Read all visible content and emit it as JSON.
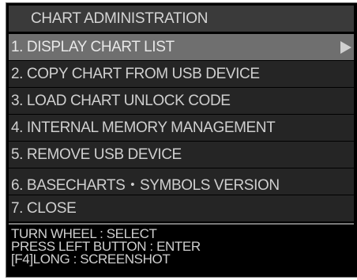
{
  "window": {
    "title": "CHART ADMINISTRATION"
  },
  "menu": {
    "items": [
      {
        "label": "1. DISPLAY CHART LIST",
        "selected": true,
        "submenu_icon": "right-triangle-arrow"
      },
      {
        "label": "2. COPY CHART FROM USB DEVICE",
        "selected": false
      },
      {
        "label": "3. LOAD CHART UNLOCK CODE",
        "selected": false
      },
      {
        "label": "4. INTERNAL MEMORY MANAGEMENT",
        "selected": false
      },
      {
        "label": "5. REMOVE USB DEVICE",
        "selected": false
      },
      {
        "label": "6. BASECHARTS・SYMBOLS VERSION",
        "selected": false
      },
      {
        "label": "7. CLOSE",
        "selected": false
      }
    ]
  },
  "help": {
    "lines": [
      "TURN WHEEL : SELECT",
      "PRESS LEFT BUTTON : ENTER",
      "[F4]LONG : SCREENSHOT"
    ]
  },
  "colors": {
    "background": "#000000",
    "item_background": "#252525",
    "selected_background": "#6f6f6f",
    "title_background": "#3a3a3a",
    "text": "#cfcfcf"
  }
}
